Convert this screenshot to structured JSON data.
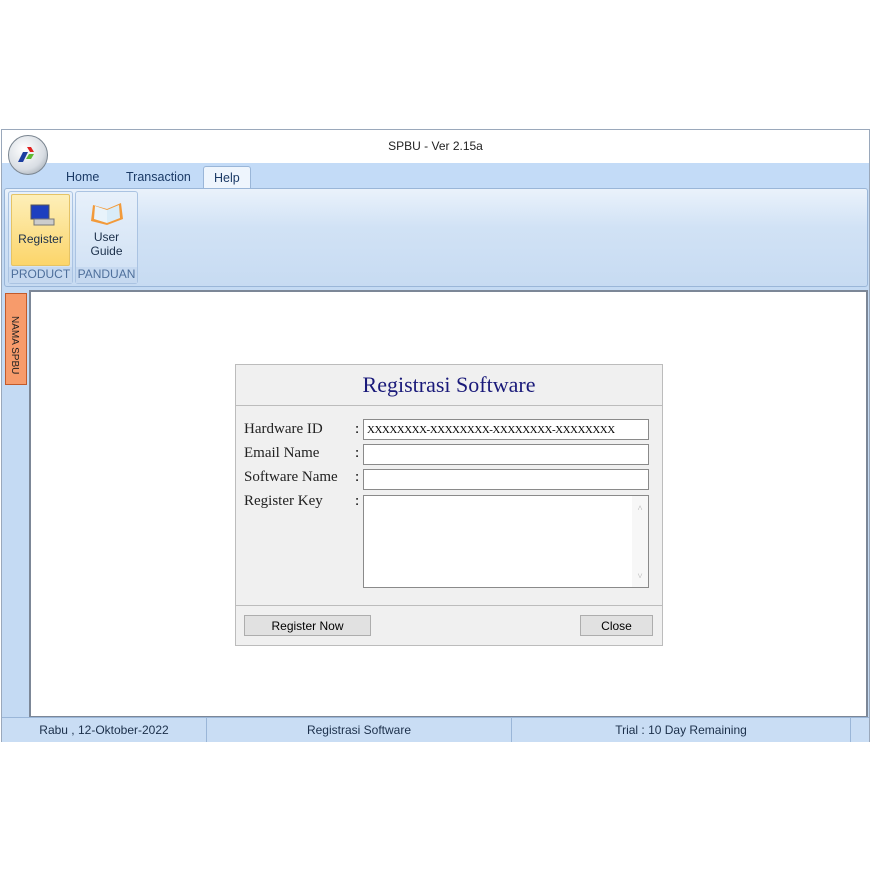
{
  "window": {
    "title": "SPBU - Ver 2.15a"
  },
  "tabs": [
    "Home",
    "Transaction",
    "Help"
  ],
  "active_tab": "Help",
  "ribbon": {
    "groups": [
      {
        "label": "PRODUCT",
        "buttons": [
          "Register"
        ]
      },
      {
        "label": "PANDUAN",
        "buttons": [
          "User\nGuide"
        ]
      }
    ],
    "user_line1": "User",
    "user_line2": "Guide"
  },
  "side_panel": {
    "label": "NAMA SPBU"
  },
  "dialog": {
    "title": "Registrasi Software",
    "fields": [
      {
        "label": "Hardware ID",
        "value": "XXXXXXXX-XXXXXXXX-XXXXXXXX-XXXXXXXX"
      },
      {
        "label": "Email Name",
        "value": ""
      },
      {
        "label": "Software Name",
        "value": ""
      },
      {
        "label": "Register Key",
        "value": ""
      }
    ],
    "colon": ":",
    "register_button": "Register Now",
    "close_button": "Close"
  },
  "statusbar": {
    "date": "Rabu , 12-Oktober-2022",
    "form": "Registrasi Software",
    "trial": "Trial : 10 Day Remaining"
  }
}
